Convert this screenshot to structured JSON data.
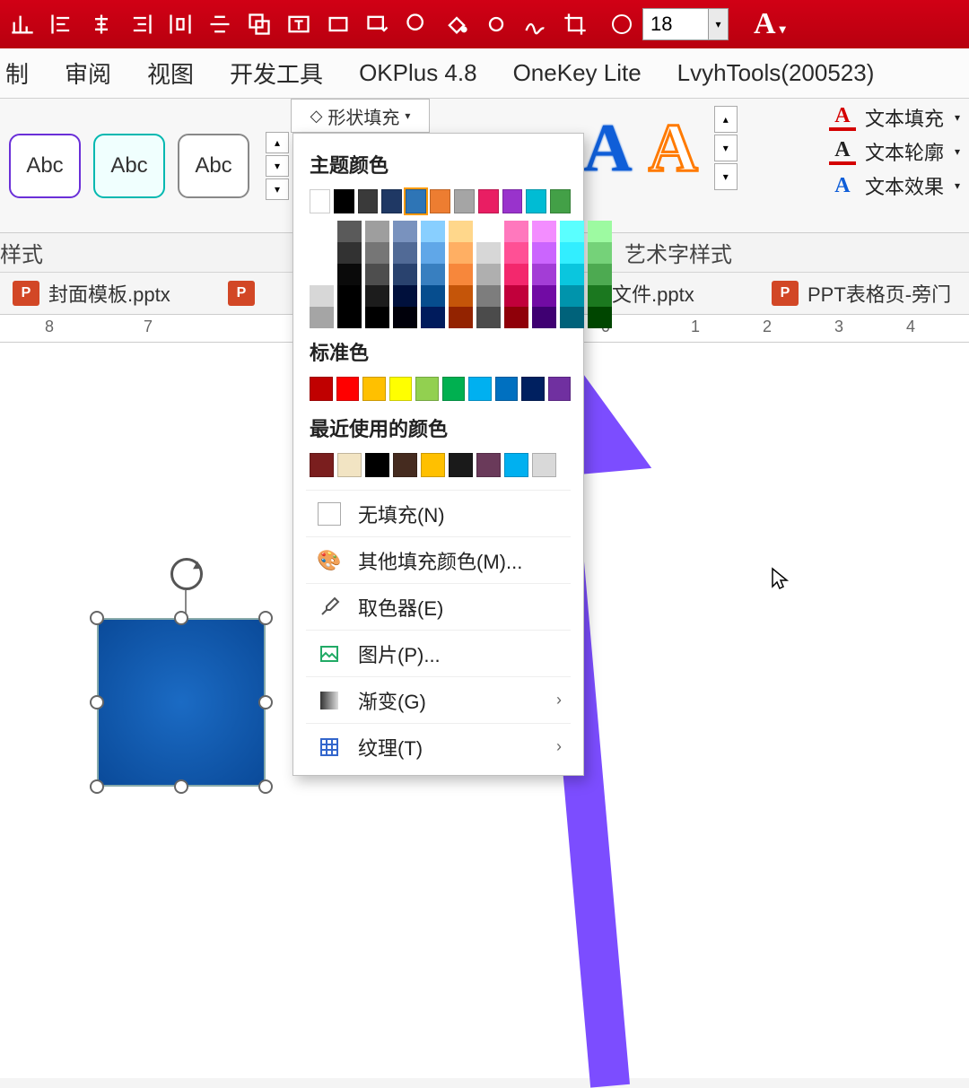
{
  "top": {
    "font_size": "18"
  },
  "menu": {
    "tabs": [
      "制",
      "审阅",
      "视图",
      "开发工具",
      "OKPlus 4.8",
      "OneKey Lite",
      "LvyhTools(200523)"
    ]
  },
  "ribbon": {
    "abc": "Abc",
    "shape_fill_label": "形状填充",
    "text_fill": "文本填充",
    "text_outline": "文本轮廓",
    "text_effect": "文本效果"
  },
  "section": {
    "style_label": "样式",
    "art_label": "艺术字样式"
  },
  "files": {
    "tab1": "封面模板.pptx",
    "tab2_suffix": "原文件.pptx",
    "tab3": "PPT表格页-旁门"
  },
  "ruler": {
    "marks_left": [
      "8",
      "7"
    ],
    "marks_right": [
      "0",
      "1",
      "2",
      "3",
      "4"
    ]
  },
  "dropdown": {
    "theme_title": "主题颜色",
    "standard_title": "标准色",
    "recent_title": "最近使用的颜色",
    "no_fill": "无填充(N)",
    "more_colors": "其他填充颜色(M)...",
    "eyedropper": "取色器(E)",
    "picture": "图片(P)...",
    "gradient": "渐变(G)",
    "texture": "纹理(T)",
    "theme_colors": [
      "#ffffff",
      "#000000",
      "#3a3a3a",
      "#1f3864",
      "#2e75b6",
      "#ed7d31",
      "#a5a5a5",
      "#e91e63",
      "#9933cc",
      "#00bcd4",
      "#43a047"
    ],
    "standard_colors": [
      "#c00000",
      "#ff0000",
      "#ffc000",
      "#ffff00",
      "#92d050",
      "#00b050",
      "#00b0f0",
      "#0070c0",
      "#002060",
      "#7030a0"
    ],
    "recent_colors": [
      "#7a1e1e",
      "#f2e4c3",
      "#000000",
      "#452b1f",
      "#ffc000",
      "#1a1a1a",
      "#6a3a5a",
      "#00b0f0",
      "#d9d9d9"
    ],
    "shade_base": [
      "#ffffff",
      "#000000",
      "#444444",
      "#1f3864",
      "#2e75b6",
      "#ed7d31",
      "#a5a5a5",
      "#e91e63",
      "#9933cc",
      "#00bcd4",
      "#43a047"
    ]
  }
}
